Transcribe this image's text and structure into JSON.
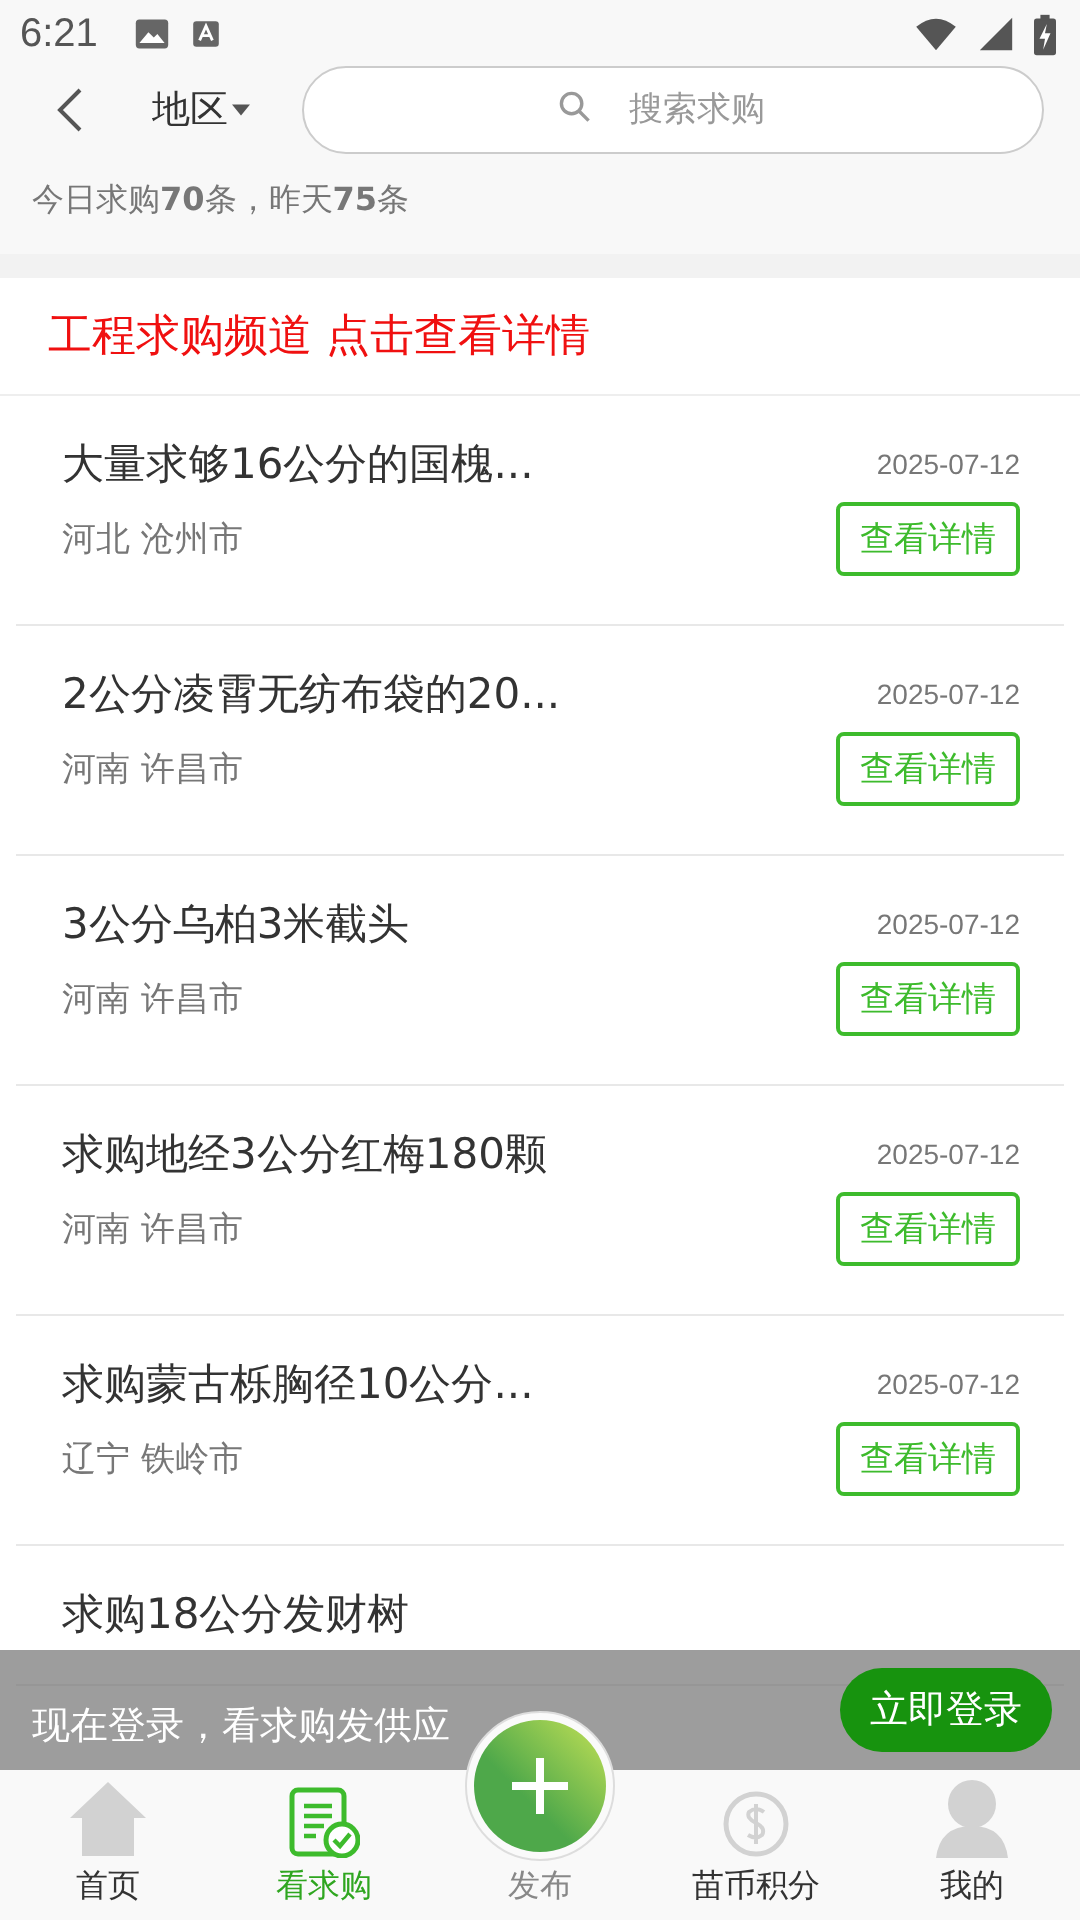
{
  "status_bar": {
    "time": "6:21"
  },
  "header": {
    "region_label": "地区",
    "search": {
      "placeholder": "搜索求购"
    }
  },
  "stats": {
    "text": "今日求购**70**条，昨天**75**条"
  },
  "banner": {
    "text": "工程求购频道 点击查看详情"
  },
  "items": [
    {
      "title": "大量求够16公分的国槐...",
      "date": "2025-07-12",
      "location": "河北 沧州市",
      "button": "查看详情"
    },
    {
      "title": "2公分凌霄无纺布袋的20...",
      "date": "2025-07-12",
      "location": "河南 许昌市",
      "button": "查看详情"
    },
    {
      "title": "3公分乌柏3米截头",
      "date": "2025-07-12",
      "location": "河南 许昌市",
      "button": "查看详情"
    },
    {
      "title": "求购地经3公分红梅180颗",
      "date": "2025-07-12",
      "location": "河南 许昌市",
      "button": "查看详情"
    },
    {
      "title": "求购蒙古栎胸径10公分...",
      "date": "2025-07-12",
      "location": "辽宁 铁岭市",
      "button": "查看详情"
    },
    {
      "title": "求购18公分发财树"
    }
  ],
  "login_bar": {
    "text": "现在登录，看求购发供应",
    "button": "立即登录"
  },
  "nav": [
    {
      "label": "首页",
      "kind": "home",
      "selected": false
    },
    {
      "label": "看求购",
      "kind": "list",
      "selected": true
    },
    {
      "label": "发布",
      "kind": "publish",
      "selected": false
    },
    {
      "label": "苗币积分",
      "kind": "coin",
      "selected": false
    },
    {
      "label": "我的",
      "kind": "person",
      "selected": false
    }
  ]
}
